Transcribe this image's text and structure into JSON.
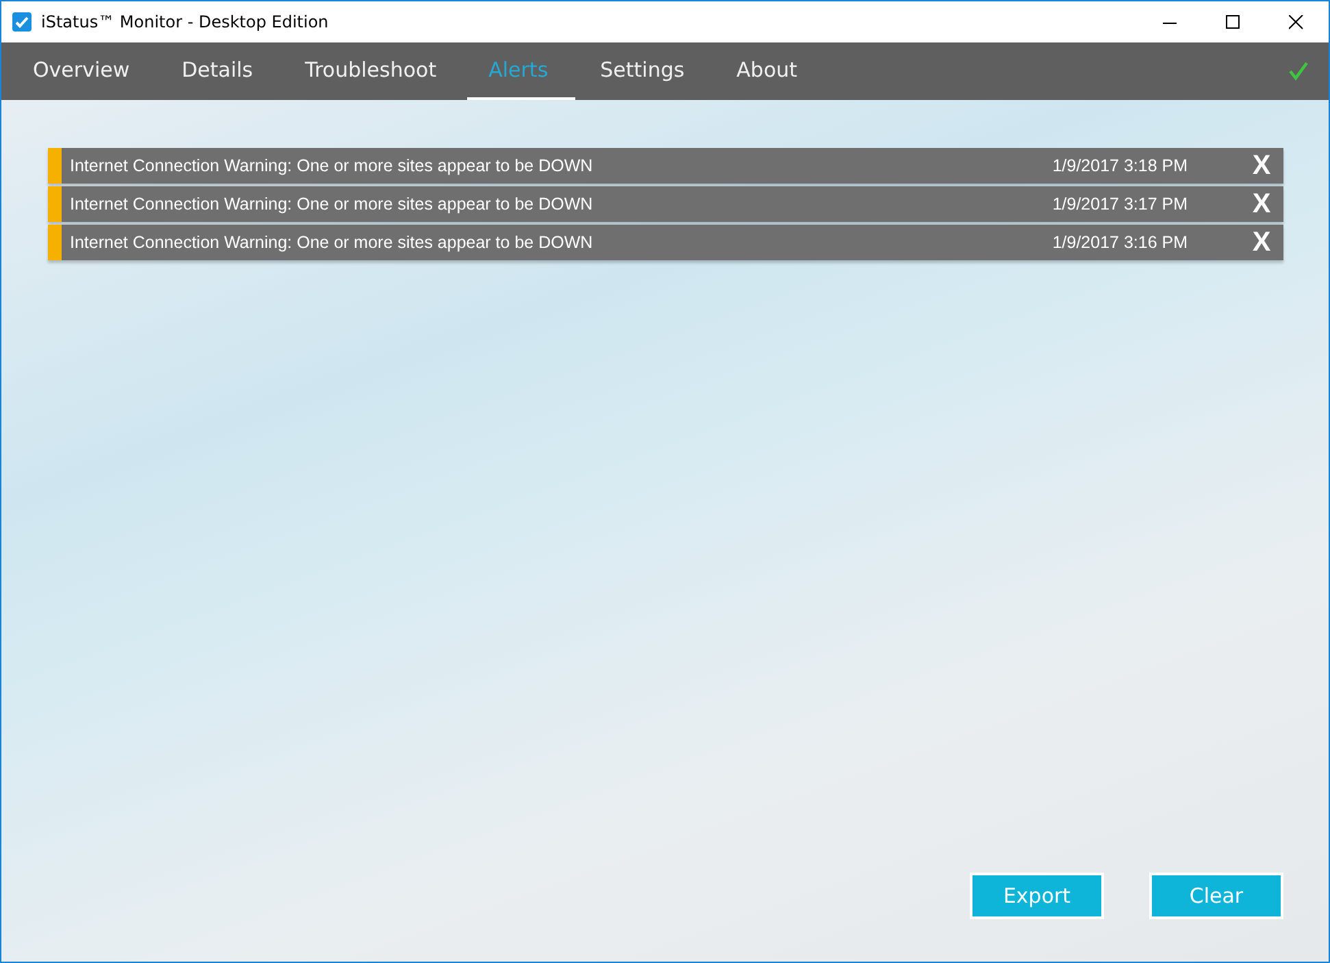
{
  "window": {
    "title": "iStatus™ Monitor - Desktop Edition"
  },
  "tabs": [
    {
      "label": "Overview",
      "selected": false
    },
    {
      "label": "Details",
      "selected": false
    },
    {
      "label": "Troubleshoot",
      "selected": false
    },
    {
      "label": "Alerts",
      "selected": true
    },
    {
      "label": "Settings",
      "selected": false
    },
    {
      "label": "About",
      "selected": false
    }
  ],
  "status_ok": true,
  "alerts": [
    {
      "message": "Internet Connection Warning: One or more sites appear to be DOWN",
      "time": "1/9/2017 3:18 PM",
      "dismiss": "X"
    },
    {
      "message": "Internet Connection Warning: One or more sites appear to be DOWN",
      "time": "1/9/2017 3:17 PM",
      "dismiss": "X"
    },
    {
      "message": "Internet Connection Warning: One or more sites appear to be DOWN",
      "time": "1/9/2017 3:16 PM",
      "dismiss": "X"
    }
  ],
  "buttons": [
    "Export",
    "Clear"
  ]
}
